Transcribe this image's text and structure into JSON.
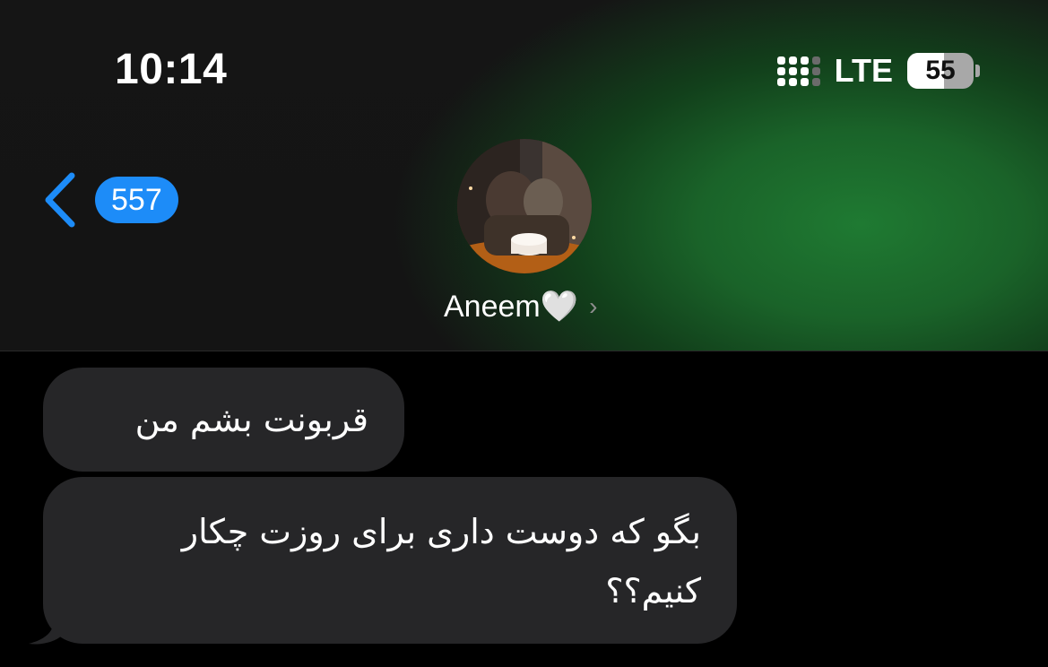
{
  "status_bar": {
    "time": "10:14",
    "network": "LTE",
    "signal_bars_filled": 3,
    "signal_bars_total": 4,
    "battery_percent": "55",
    "battery_level": 0.55
  },
  "nav": {
    "back_icon": "chevron-left-icon",
    "unread_count": "557",
    "accent_color": "#1d8cf8"
  },
  "contact": {
    "name": "Aneem",
    "heart": "🤍",
    "chevron_icon": "chevron-right-icon"
  },
  "messages": [
    {
      "direction": "incoming",
      "text": "قربونت بشم من"
    },
    {
      "direction": "incoming",
      "text_line1": "بگو که دوست داری برای روزت چکار",
      "text_line2": "کنیم؟؟"
    }
  ],
  "colors": {
    "header_bg": "#151515",
    "header_glow": "#1f7a32",
    "bubble_bg": "#262628"
  }
}
